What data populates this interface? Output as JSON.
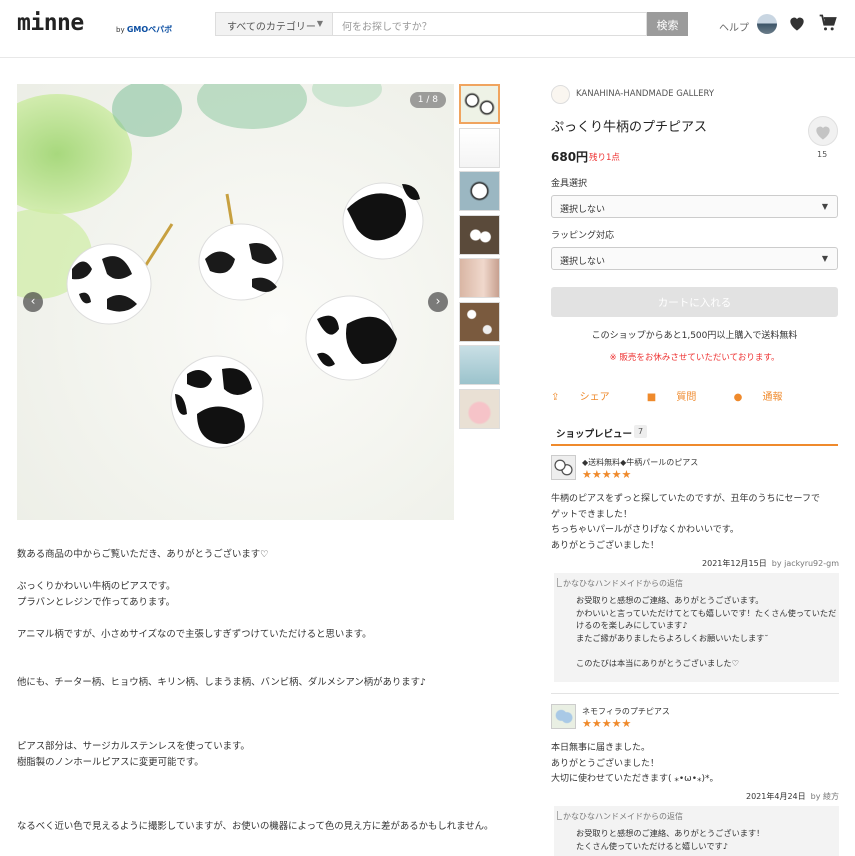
{
  "header": {
    "logo": "minne",
    "logo_sub_prefix": "by",
    "logo_sub_brand": "GMO",
    "logo_sub_suffix": "ペパボ",
    "category_label": "すべてのカテゴリー",
    "search_placeholder": "何をお探しですか？",
    "search_button": "検索",
    "help_label": "ヘルプ"
  },
  "gallery": {
    "counter": "1 / 8",
    "prev": "‹",
    "next": "›",
    "thumbnails": 8
  },
  "description": [
    "数ある商品の中からご覧いただき、ありがとうございます♡",
    "",
    "ぷっくりかわいい牛柄のピアスです。",
    "プラバンとレジンで作ってあります。",
    "",
    "アニマル柄ですが、小さめサイズなので主張しすぎずつけていただけると思います。",
    "",
    "",
    "他にも、チーター柄、ヒョウ柄、キリン柄、しまうま柄、バンビ柄、ダルメシアン柄があります♪",
    "",
    "",
    "",
    "ピアス部分は、サージカルステンレスを使っています。",
    "樹脂製のノンホールピアスに変更可能です。",
    "",
    "",
    "",
    "なるべく近い色で見えるように撮影していますが、お使いの機器によって色の見え方に差があるかもしれません。"
  ],
  "product": {
    "shop_name": "KANAHINA-HANDMADE GALLERY",
    "title": "ぷっくり牛柄のプチピアス",
    "price": "680円",
    "stock": "残り1点",
    "favorite_count": "15",
    "option1_label": "金具選択",
    "option1_value": "選択しない",
    "option2_label": "ラッピング対応",
    "option2_value": "選択しない",
    "cart_button": "カートに入れる",
    "shipping_note": "このショップからあと1,500円以上購入で送料無料",
    "closed_note": "※ 販売をお休みさせていただいております。",
    "share": "シェア",
    "question": "質問",
    "report": "通報"
  },
  "reviews": {
    "tab_label": "ショップレビュー",
    "count": "7",
    "items": [
      {
        "title": "◆送料無料◆牛柄パールのピアス",
        "stars": "★★★★★",
        "body": [
          "牛柄のピアスをずっと探していたのですが、丑年のうちにセーフで",
          "ゲットできました！",
          "ちっちゃいパールがさりげなくかわいいです。",
          "ありがとうございました！"
        ],
        "date": "2021年12月15日",
        "author": "by jackyru92-gm",
        "reply_from": "かなひなハンドメイドからの返信",
        "reply": [
          "お受取りと感想のご連絡、ありがとうございます。",
          "かわいいと言っていただけてとても嬉しいです！たくさん使っていただ",
          "けるのを楽しみにしています♪",
          "またご縁がありましたらよろしくお願いいたします˘",
          "",
          "このたびは本当にありがとうございました♡"
        ]
      },
      {
        "title": "ネモフィラのプチピアス",
        "stars": "★★★★★",
        "body": [
          "本日無事に届きました。",
          "ありがとうございました！",
          "大切に使わせていただきます( ⁎•ω•⁎)*。"
        ],
        "date": "2021年4月24日",
        "author": "by 綾方",
        "reply_from": "かなひなハンドメイドからの返信",
        "reply": [
          "お受取りと感想のご連絡、ありがとうございます！",
          "たくさん使っていただけると嬉しいです♪"
        ]
      }
    ]
  }
}
